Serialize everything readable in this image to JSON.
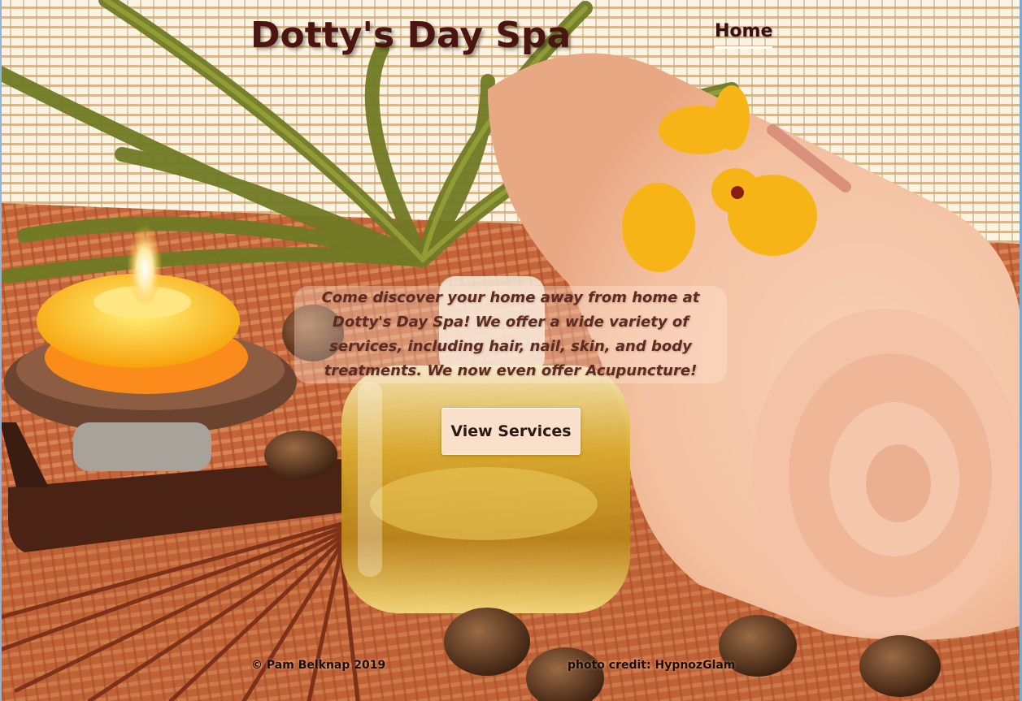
{
  "site": {
    "title": "Dotty's Day Spa"
  },
  "nav": {
    "items": [
      {
        "label": "Home",
        "active": true
      }
    ]
  },
  "hero": {
    "intro": "Come discover your home away from home at Dotty's Day Spa! We offer a wide variety of services, including hair, nail, skin, and body treatments. We now even offer Acupuncture!",
    "button_label": "View Services",
    "background_description_icons": [
      "candle-icon",
      "palm-leaves-icon",
      "towel-icon",
      "oil-bottle-icon",
      "orchid-icon",
      "incense-sticks-icon",
      "stones-icon"
    ]
  },
  "footer": {
    "copyright": "© Pam Belknap 2019",
    "photo_credit": "photo credit: HypnozGlam"
  },
  "colors": {
    "title": "#4a1410",
    "nav_text": "#3b0e0c",
    "button_bg": "#fae0cb",
    "intro_text": "#5e2a22",
    "towel": "#f6c8ad",
    "mat": "#c8653c",
    "blind": "#f3e6cf"
  }
}
